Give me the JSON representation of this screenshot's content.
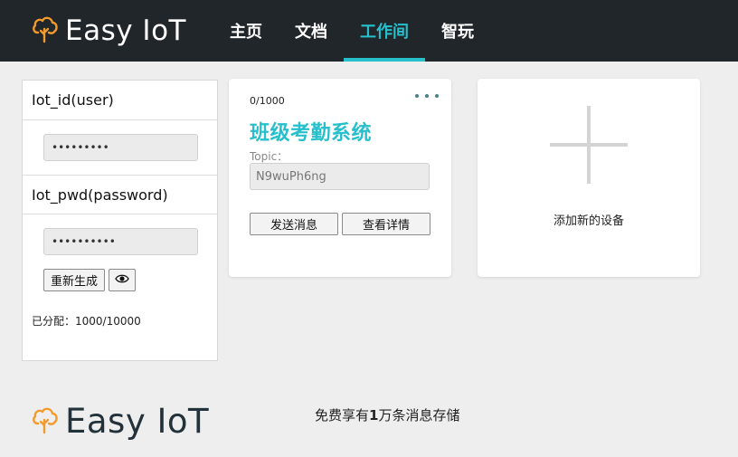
{
  "app": {
    "brand": "Easy IoT",
    "brand_color": "#f29b2a",
    "accent_color": "#26c0cc"
  },
  "nav": {
    "items": [
      {
        "label": "主页",
        "active": false
      },
      {
        "label": "文档",
        "active": false
      },
      {
        "label": "工作间",
        "active": true
      },
      {
        "label": "智玩",
        "active": false
      }
    ]
  },
  "credentials": {
    "user_title": "Iot_id(user)",
    "user_value": "•••••••••",
    "pwd_title": "Iot_pwd(password)",
    "pwd_value": "••••••••••",
    "regenerate_label": "重新生成",
    "show_icon": "eye-icon",
    "assigned_label": "已分配：1000/10000"
  },
  "device": {
    "count": "0/1000",
    "name": "班级考勤系统",
    "topic_label": "Topic：",
    "topic_value": "N9wuPh6ng",
    "send_label": "发送消息",
    "detail_label": "查看详情"
  },
  "add_device": {
    "label": "添加新的设备"
  },
  "footer": {
    "brand": "Easy IoT",
    "note_prefix": "免费享有",
    "note_number": "1",
    "note_suffix": "万条消息存储"
  }
}
